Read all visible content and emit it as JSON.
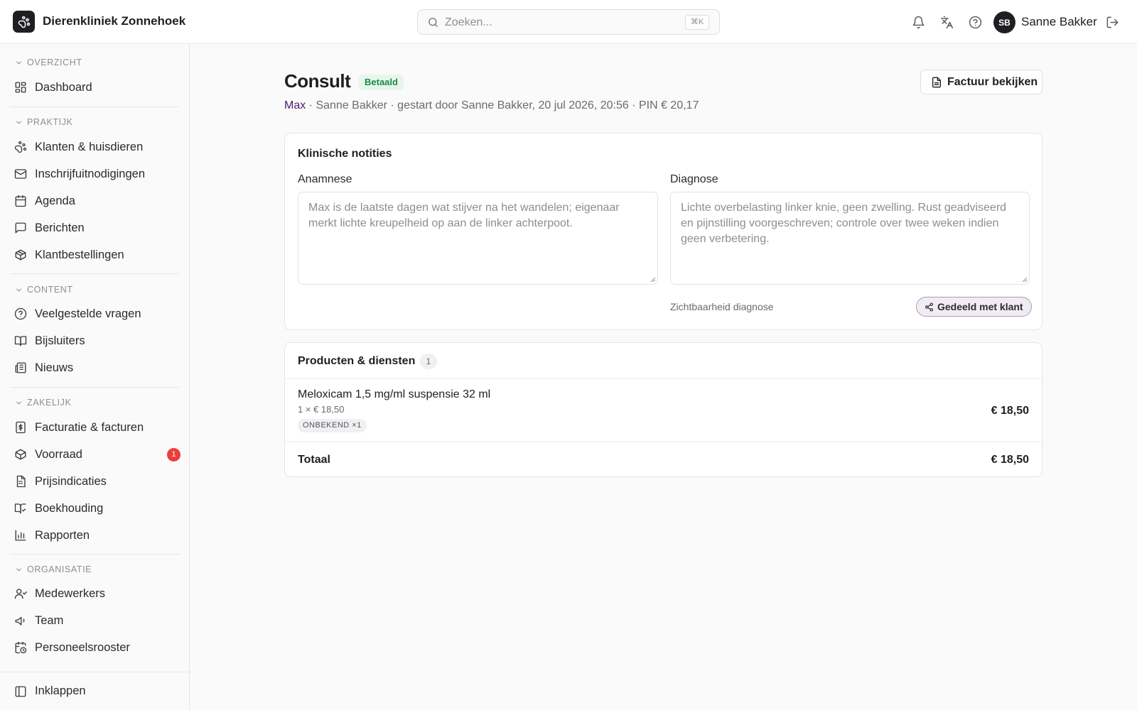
{
  "header": {
    "clinic_name": "Dierenkliniek Zonnehoek",
    "search_placeholder": "Zoeken...",
    "search_shortcut": "⌘K",
    "user_initials": "SB",
    "user_name": "Sanne Bakker"
  },
  "sidebar": {
    "sections": [
      {
        "title": "OVERZICHT",
        "items": [
          {
            "label": "Dashboard",
            "icon": "dashboard-icon"
          }
        ]
      },
      {
        "title": "PRAKTIJK",
        "items": [
          {
            "label": "Klanten & huisdieren",
            "icon": "paw-icon"
          },
          {
            "label": "Inschrijfuitnodigingen",
            "icon": "mail-icon"
          },
          {
            "label": "Agenda",
            "icon": "calendar-icon"
          },
          {
            "label": "Berichten",
            "icon": "message-icon"
          },
          {
            "label": "Klantbestellingen",
            "icon": "package-icon"
          }
        ]
      },
      {
        "title": "CONTENT",
        "items": [
          {
            "label": "Veelgestelde vragen",
            "icon": "help-circle-icon"
          },
          {
            "label": "Bijsluiters",
            "icon": "book-open-icon"
          },
          {
            "label": "Nieuws",
            "icon": "newspaper-icon"
          }
        ]
      },
      {
        "title": "ZAKELIJK",
        "items": [
          {
            "label": "Facturatie & facturen",
            "icon": "receipt-icon"
          },
          {
            "label": "Voorraad",
            "icon": "box-icon",
            "badge": "1"
          },
          {
            "label": "Prijsindicaties",
            "icon": "calculator-icon"
          },
          {
            "label": "Boekhouding",
            "icon": "ledger-icon"
          },
          {
            "label": "Rapporten",
            "icon": "bar-chart-icon"
          }
        ]
      },
      {
        "title": "ORGANISATIE",
        "items": [
          {
            "label": "Medewerkers",
            "icon": "users-icon"
          },
          {
            "label": "Team",
            "icon": "megaphone-icon"
          },
          {
            "label": "Personeelsrooster",
            "icon": "calendar-clock-icon"
          }
        ]
      }
    ],
    "collapse_label": "Inklappen"
  },
  "consult": {
    "title": "Consult",
    "status": "Betaald",
    "pet_name": "Max",
    "meta_rest": " · Sanne Bakker · gestart door Sanne Bakker, 20 jul 2026, 20:56 · PIN € 20,17",
    "invoice_button": "Factuur bekijken"
  },
  "notes": {
    "title": "Klinische notities",
    "anamnese_label": "Anamnese",
    "anamnese_text": "Max is de laatste dagen wat stijver na het wandelen; eigenaar merkt lichte kreupelheid op aan de linker achterpoot.",
    "diagnose_label": "Diagnose",
    "diagnose_text": "Lichte overbelasting linker knie, geen zwelling. Rust geadviseerd en pijnstilling voorgeschreven; controle over twee weken indien geen verbetering.",
    "visibility_label": "Zichtbaarheid diagnose",
    "shared_label": "Gedeeld met klant"
  },
  "products": {
    "title": "Producten & diensten",
    "count": "1",
    "items": [
      {
        "name": "Meloxicam 1,5 mg/ml suspensie 32 ml",
        "qty_price": "1 × € 18,50",
        "batch": "ONBEKEND ×1",
        "amount": "€ 18,50"
      }
    ],
    "total_label": "Totaal",
    "total_amount": "€ 18,50"
  },
  "colors": {
    "accent": "#1f1f23",
    "paid_green": "#1c8a4a",
    "badge_red": "#ea3e3e",
    "pet_link": "#4a1f6b"
  }
}
